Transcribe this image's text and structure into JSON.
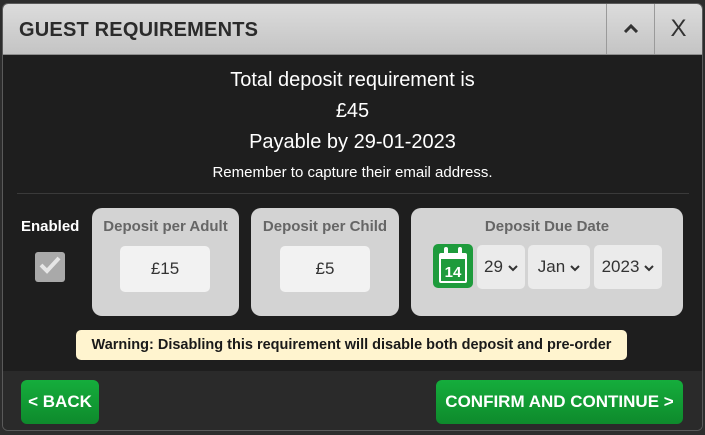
{
  "dialog": {
    "title": "GUEST REQUIREMENTS",
    "close_label": "X"
  },
  "summary": {
    "line1": "Total deposit requirement is",
    "amount": "£45",
    "payable": "Payable by 29-01-2023",
    "reminder": "Remember to capture their email address."
  },
  "enabled": {
    "label": "Enabled",
    "checked": true
  },
  "adult": {
    "label": "Deposit per Adult",
    "value": "£15"
  },
  "child": {
    "label": "Deposit per Child",
    "value": "£5"
  },
  "due_date": {
    "label": "Deposit Due Date",
    "calendar_day": "14",
    "day": "29",
    "month": "Jan",
    "year": "2023"
  },
  "warning": "Warning: Disabling this requirement will disable both deposit and pre-order",
  "footer": {
    "back_label": "< BACK",
    "confirm_label": "CONFIRM AND CONTINUE >"
  },
  "colors": {
    "accent_green": "#15ad3c",
    "warning_bg": "#fff4cf"
  }
}
